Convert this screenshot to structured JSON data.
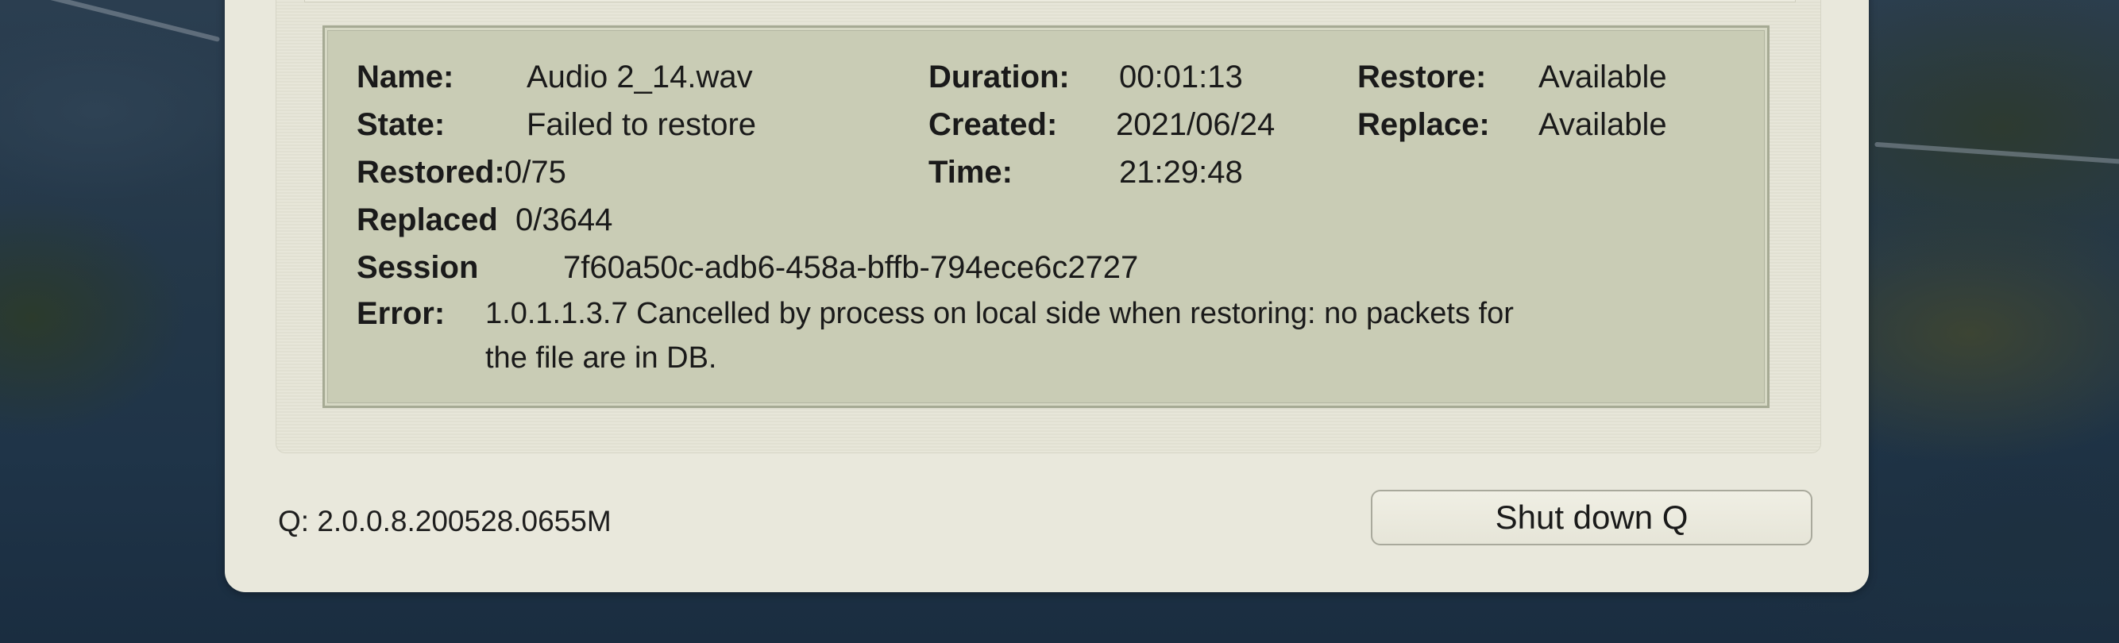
{
  "details": {
    "name_label": "Name:",
    "name_value": "Audio 2_14.wav",
    "state_label": "State:",
    "state_value": "Failed to restore",
    "restored_label": "Restored:",
    "restored_value": "0/75",
    "replaced_label": "Replaced",
    "replaced_value": "0/3644",
    "session_label": "Session",
    "session_value": "7f60a50c-adb6-458a-bffb-794ece6c2727",
    "error_label": "Error:",
    "error_line1": "1.0.1.1.3.7 Cancelled by process on local side when restoring: no packets for",
    "error_line2": "the file are in DB.",
    "duration_label": "Duration:",
    "duration_value": "00:01:13",
    "created_label": "Created:",
    "created_value": "2021/06/24",
    "time_label": "Time:",
    "time_value": "21:29:48",
    "restore_label": "Restore:",
    "restore_value": "Available",
    "replace_label": "Replace:",
    "replace_value": "Available"
  },
  "footer": {
    "version": "Q: 2.0.0.8.200528.0655M",
    "shutdown_label": "Shut down Q"
  },
  "colors": {
    "panel_bg": "#e9e8dc",
    "info_box_bg": "#c9ccb5",
    "text": "#1a1a1a"
  }
}
